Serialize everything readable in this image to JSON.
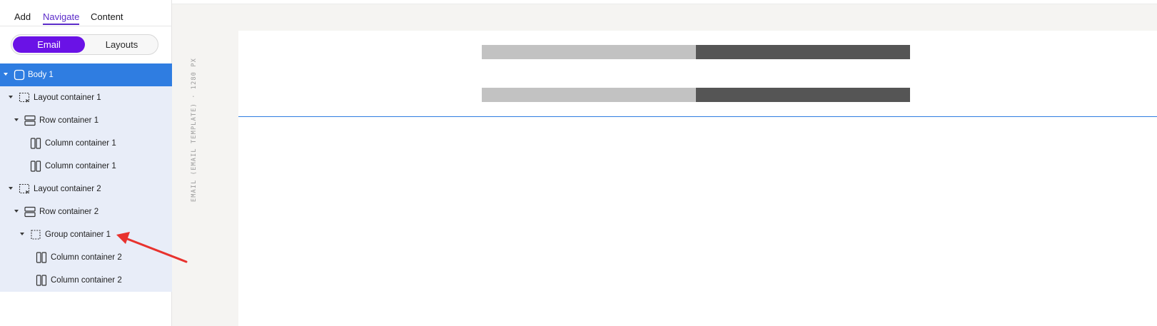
{
  "sidebar": {
    "tabs": [
      {
        "label": "Add"
      },
      {
        "label": "Navigate"
      },
      {
        "label": "Content"
      }
    ],
    "active_tab": "Navigate",
    "toggle": {
      "options": [
        "Email",
        "Layouts"
      ],
      "selected": "Email"
    },
    "tree": [
      {
        "label": "Body 1",
        "icon": "square-icon",
        "selected": true
      },
      {
        "label": "Layout container 1",
        "icon": "layout-container-icon"
      },
      {
        "label": "Row container 1",
        "icon": "row-container-icon"
      },
      {
        "label": "Column container 1",
        "icon": "column-container-icon"
      },
      {
        "label": "Column container 1",
        "icon": "column-container-icon"
      },
      {
        "label": "Layout container 2",
        "icon": "layout-container-icon"
      },
      {
        "label": "Row container 2",
        "icon": "row-container-icon"
      },
      {
        "label": "Group container 1",
        "icon": "group-container-icon"
      },
      {
        "label": "Column container 2",
        "icon": "column-container-icon"
      },
      {
        "label": "Column container 2",
        "icon": "column-container-icon"
      }
    ]
  },
  "canvas": {
    "vertical_label": "EMAIL (EMAIL TEMPLATE) · 1280 PX"
  },
  "colors": {
    "accent": "#6a12e6",
    "selection": "#2f7de1",
    "tree_bg": "#e8edf8",
    "bar_light": "#c2c2c2",
    "bar_dark": "#555555",
    "annotation_arrow": "#e8322e"
  }
}
